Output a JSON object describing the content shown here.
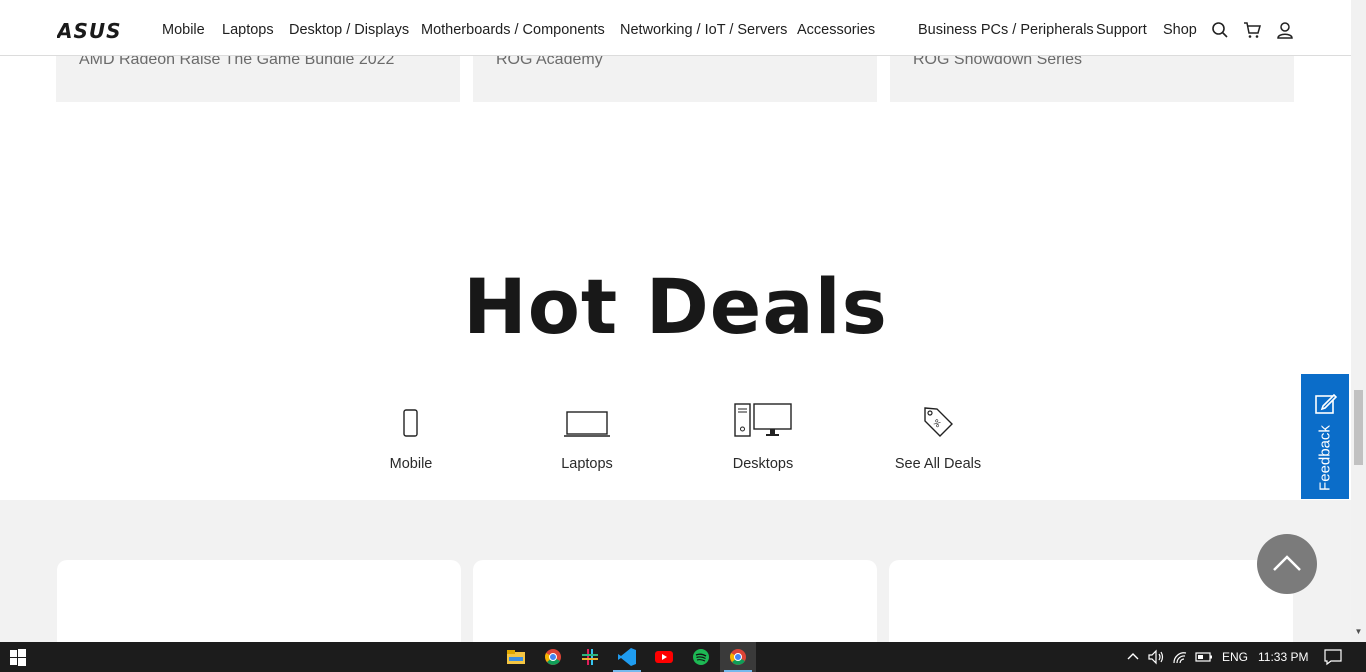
{
  "nav": {
    "brand": "ASUS",
    "links": [
      "Mobile",
      "Laptops",
      "Desktop / Displays",
      "Motherboards / Components",
      "Networking / IoT / Servers",
      "Accessories",
      "Business PCs / Peripherals",
      "Support",
      "Shop"
    ],
    "icons": [
      "search-icon",
      "cart-icon",
      "user-icon"
    ]
  },
  "promos": [
    "AMD Radeon Raise The Game Bundle 2022",
    "ROG Academy",
    "ROG Showdown Series"
  ],
  "hot_deals": {
    "title": "Hot Deals",
    "categories": [
      {
        "label": "Mobile",
        "icon": "phone-icon"
      },
      {
        "label": "Laptops",
        "icon": "laptop-icon"
      },
      {
        "label": "Desktops",
        "icon": "desktop-icon"
      },
      {
        "label": "See All Deals",
        "icon": "price-tag-icon"
      }
    ]
  },
  "feedback": {
    "label": "Feedback"
  },
  "taskbar": {
    "language": "ENG",
    "time": "11:33 PM"
  },
  "colors": {
    "feedback_blue": "#0b6dc9",
    "totop_gray": "#7b7b7b",
    "section_gray": "#f2f2f2",
    "taskbar": "#1c1c1c"
  }
}
